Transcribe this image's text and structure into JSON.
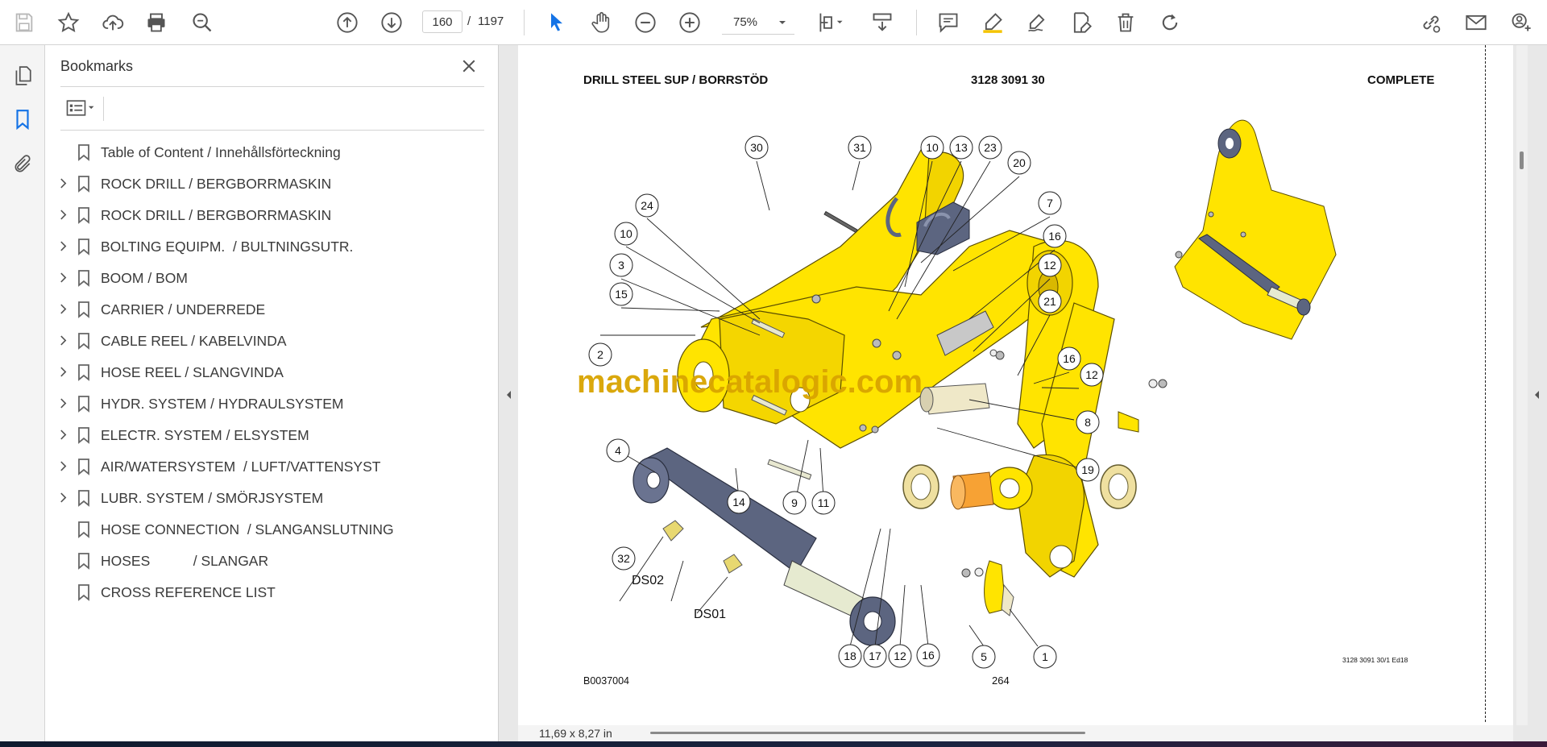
{
  "toolbar": {
    "page_current": "160",
    "page_separator": "/",
    "page_total": "1197",
    "zoom": "75%"
  },
  "sidebar": {
    "title": "Bookmarks",
    "items": [
      {
        "label": "Table of Content / Innehållsförteckning",
        "expandable": false
      },
      {
        "label": "ROCK DRILL / BERGBORRMASKIN",
        "expandable": true
      },
      {
        "label": "ROCK DRILL / BERGBORRMASKIN",
        "expandable": true
      },
      {
        "label": "BOLTING EQUIPM.  / BULTNINGSUTR.",
        "expandable": true
      },
      {
        "label": "BOOM / BOM",
        "expandable": true
      },
      {
        "label": "CARRIER / UNDERREDE",
        "expandable": true
      },
      {
        "label": "CABLE REEL / KABELVINDA",
        "expandable": true
      },
      {
        "label": "HOSE REEL / SLANGVINDA",
        "expandable": true
      },
      {
        "label": "HYDR. SYSTEM / HYDRAULSYSTEM",
        "expandable": true
      },
      {
        "label": "ELECTR. SYSTEM / ELSYSTEM",
        "expandable": true
      },
      {
        "label": "AIR/WATERSYSTEM  / LUFT/VATTENSYST",
        "expandable": true
      },
      {
        "label": "LUBR. SYSTEM / SMÖRJSYSTEM",
        "expandable": true
      },
      {
        "label": "HOSE CONNECTION  / SLANGANSLUTNING",
        "expandable": false
      },
      {
        "label": "HOSES           / SLANGAR",
        "expandable": false
      },
      {
        "label": "CROSS REFERENCE LIST",
        "expandable": false
      }
    ]
  },
  "document": {
    "header_left": "DRILL STEEL SUP / BORRSTÖD",
    "header_center": "3128 3091 30",
    "header_right": "COMPLETE",
    "watermark": "machinecatalogic.com",
    "footer_left": "B0037004",
    "footer_center": "264",
    "footer_right": "3128 3091 30/1 Ed18",
    "callouts": [
      "30",
      "31",
      "10",
      "13",
      "23",
      "20",
      "24",
      "10",
      "7",
      "16",
      "3",
      "12",
      "15",
      "21",
      "2",
      "16",
      "12",
      "8",
      "19",
      "4",
      "14",
      "9",
      "11",
      "32",
      "18",
      "17",
      "12",
      "16",
      "5",
      "1"
    ],
    "connector_labels": [
      "DS02",
      "DS01"
    ]
  },
  "status": {
    "page_size": "11,69 x 8,27 in"
  },
  "colors": {
    "part_yellow": "#ffe400",
    "cylinder": "#5c6580",
    "watermark": "#d9a400",
    "bushing": "#f7a234",
    "accent_blue": "#1473e6"
  }
}
